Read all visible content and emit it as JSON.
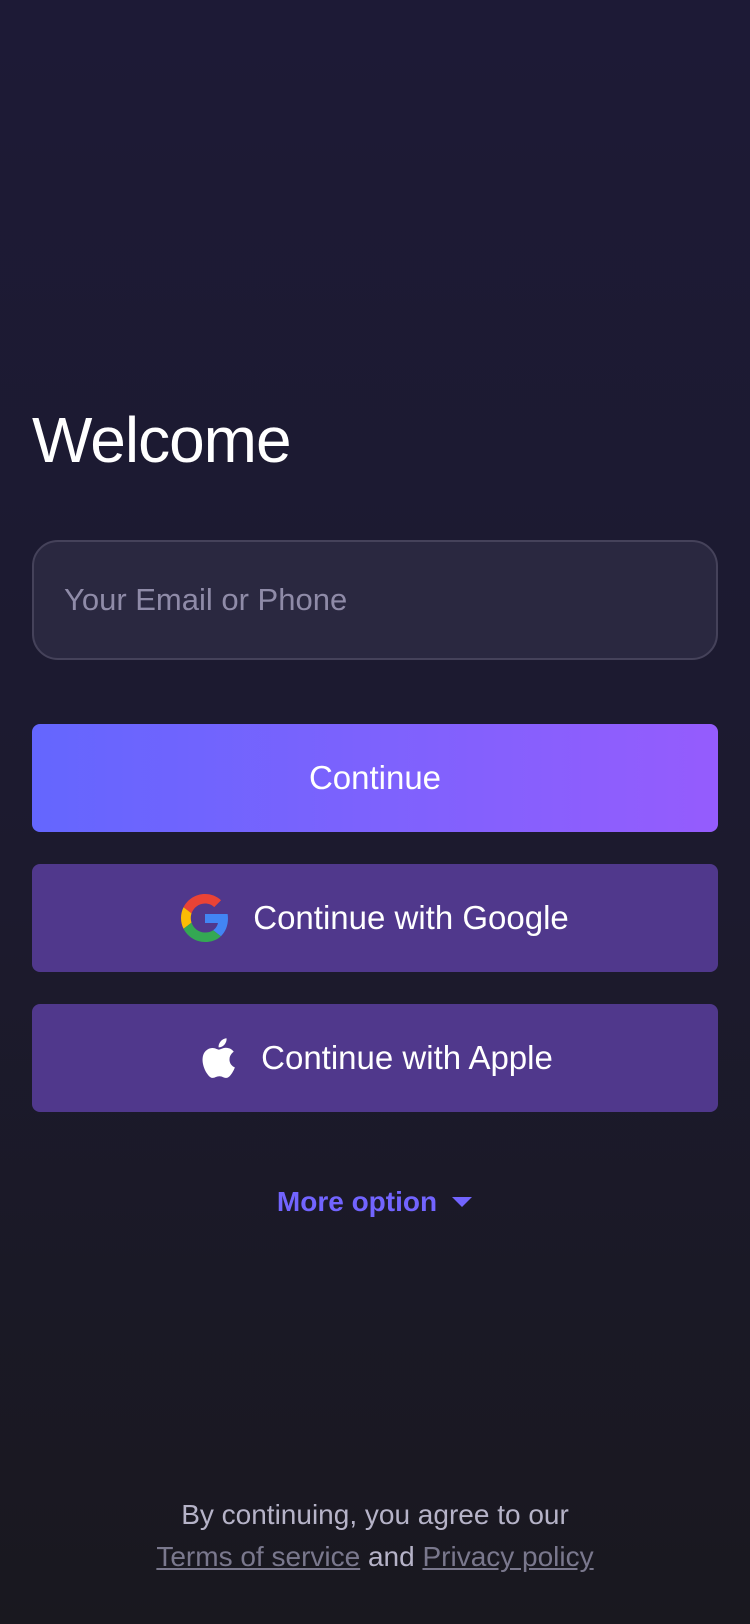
{
  "title": "Welcome",
  "login_input": {
    "placeholder": "Your Email or Phone",
    "value": ""
  },
  "buttons": {
    "continue": "Continue",
    "google": "Continue with Google",
    "apple": "Continue with Apple"
  },
  "more_option": "More option",
  "legal": {
    "prefix": "By continuing, you agree to our",
    "terms": "Terms of service",
    "and": "and",
    "privacy": "Privacy policy"
  },
  "icons": {
    "google": "google-logo-icon",
    "apple": "apple-logo-icon",
    "caret": "caret-down-icon"
  },
  "colors": {
    "accent": "#7264ff",
    "primary_start": "#6466fe",
    "primary_end": "#955cfd",
    "secondary_button": "#50388c"
  }
}
